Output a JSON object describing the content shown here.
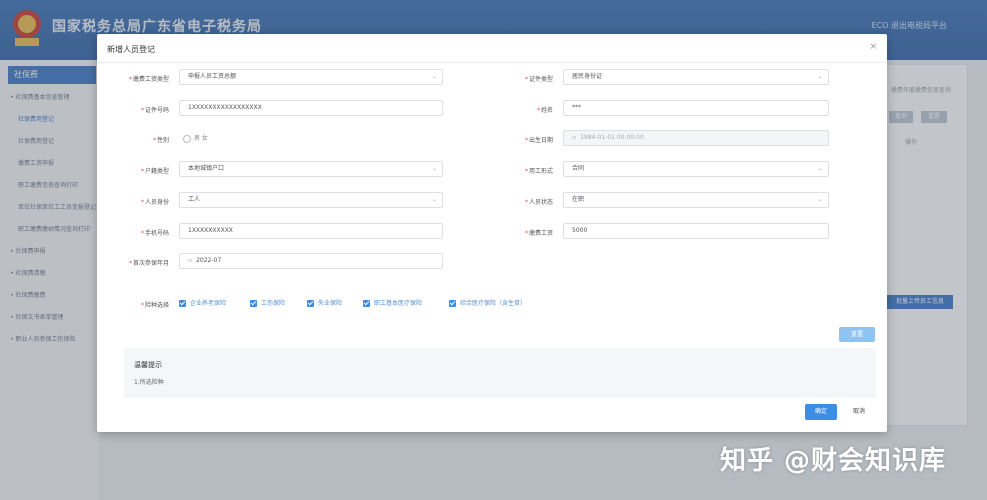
{
  "header": {
    "title": "国家税务总局广东省电子税务局",
    "user": "ECO   退出电税局平台"
  },
  "sidebar": {
    "section": "社保费",
    "items": [
      "• 社保费基本信息管理",
      "社保费用登记",
      "社保费用登记",
      "缴费工资申报",
      "职工缴费信息查询打印",
      "单位社保单位工工员变报登记",
      "职工缴费缴纳情况查询打印",
      "• 社保费申报",
      "• 社保费清缴",
      "• 社保费缴费",
      "• 社保文书表单管理",
      "• 职业人员参保工伤保险"
    ]
  },
  "right_panel": {
    "top_text": "缴费年度缴费信息查询",
    "btn_search": "查询",
    "btn_reset": "重置",
    "col_label": "操作",
    "btn_upload": "批量上传员工信息"
  },
  "modal": {
    "title": "新增人员登记",
    "close": "×",
    "left_fields": [
      {
        "label": "证件号码",
        "value": "1XXXXXXXXXXXXXXXXX"
      },
      {
        "label": "性别",
        "value": "男  女"
      },
      {
        "label": "户籍类型",
        "value": "本地城镇户口"
      },
      {
        "label": "人员身份",
        "value": "工人"
      },
      {
        "label": "手机号码",
        "value": "1XXXXXXXXXX"
      },
      {
        "label": "首次参保年月",
        "value": "2022-07"
      }
    ],
    "first_left": {
      "label": "缴费工资类型",
      "value": "申报人员工资总额"
    },
    "right_fields": [
      {
        "label": "证件类型",
        "value": "居民身份证"
      },
      {
        "label": "姓名",
        "value": "***"
      },
      {
        "label": "出生日期",
        "value": "1984-01-01 00:00:00"
      },
      {
        "label": "用工形式",
        "value": "合同"
      },
      {
        "label": "人员状态",
        "value": "在职"
      },
      {
        "label": "缴费工资",
        "value": "5000"
      }
    ],
    "insurance_label": "险种选择",
    "insurances": [
      "企业养老保险",
      "工伤保险",
      "失业保险",
      "职工基本医疗保险",
      "综合医疗保险（含生育）"
    ],
    "reset_btn": "重置",
    "tips_title": "温馨提示",
    "tips_text": "1.所选险种",
    "ok_btn": "确定",
    "cancel_btn": "取消"
  },
  "watermark": "知乎 @财会知识库",
  "colors": {
    "accent": "#3a8ee6",
    "header": "#2f63a6"
  }
}
